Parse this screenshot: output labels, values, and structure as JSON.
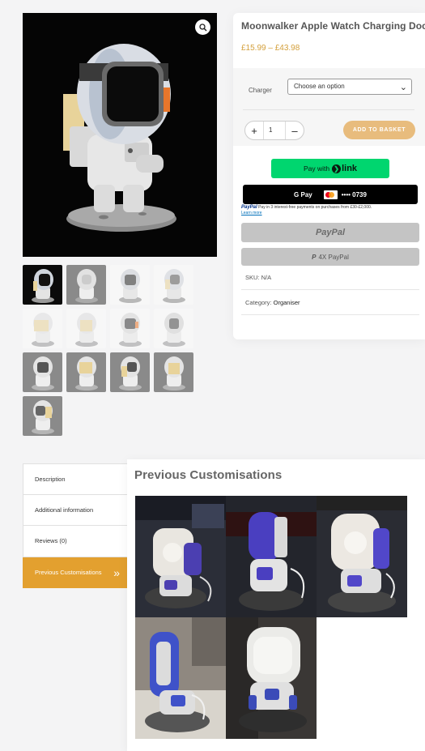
{
  "product": {
    "title": "Moonwalker Apple Watch Charging Dock",
    "price_range": "£15.99 – £43.98"
  },
  "gallery": {
    "zoom_icon": "magnifier-icon",
    "thumbnail_count": 13
  },
  "cart": {
    "variation_label": "Charger",
    "variation_placeholder": "Choose an option",
    "quantity_value": "1",
    "qty_plus": "+",
    "qty_minus": "–",
    "add_to_basket": "ADD TO BASKET"
  },
  "payments": {
    "link_prefix": "Pay with",
    "link_brand": "link",
    "gpay_label": "G Pay",
    "gpay_card_digits": "•••• 0739",
    "paylater_brand": "PayPal",
    "paylater_text": "Pay in 3 interest-free payments on purchases from £30-£2,000.",
    "paylater_learn": "Learn more",
    "paypal_button": "PayPal",
    "paypal_4x_button": "4X PayPal"
  },
  "meta": {
    "sku_label": "SKU:",
    "sku_value": "N/A",
    "category_label": "Category:",
    "category_value": "Organiser"
  },
  "tabs": [
    {
      "label": "Description"
    },
    {
      "label": "Additional information"
    },
    {
      "label": "Reviews (0)"
    },
    {
      "label": "Previous Customisations"
    }
  ],
  "panel": {
    "title": "Previous Customisations",
    "photo_count": 5
  },
  "colors": {
    "accent": "#e3a02f",
    "price": "#d4a03c",
    "link_green": "#00d66f"
  }
}
